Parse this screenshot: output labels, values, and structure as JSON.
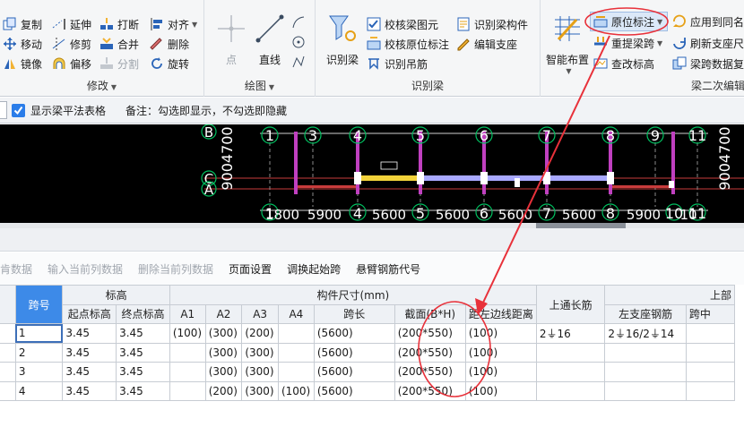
{
  "ribbon": {
    "modify": {
      "label": "修改",
      "col1": [
        "复制",
        "移动",
        "镜像"
      ],
      "col2": [
        "延伸",
        "修剪",
        "偏移"
      ],
      "col3": [
        "打断",
        "合并",
        "分割"
      ],
      "col4": [
        "对齐",
        "删除",
        "旋转"
      ]
    },
    "draw": {
      "label": "绘图",
      "point": "点",
      "line": "直线"
    },
    "identify": {
      "label": "识别梁",
      "big": "识别梁",
      "col1": [
        "校核梁图元",
        "校核原位标注",
        "识别吊筋"
      ],
      "col2": [
        "识别梁构件",
        "编辑支座"
      ]
    },
    "secondary": {
      "label": "梁二次编辑",
      "smart_layout": "智能布置",
      "col1": [
        "原位标注",
        "重提梁跨",
        "查改标高"
      ],
      "col2": [
        "应用到同名梁",
        "刷新支座尺寸",
        "梁跨数据复制"
      ]
    }
  },
  "options": {
    "show_table_label": "显示梁平法表格",
    "note": "备注：勾选即显示，不勾选即隐藏"
  },
  "canvas": {
    "axes": [
      "1",
      "3",
      "4",
      "5",
      "6",
      "7",
      "8",
      "9",
      "11"
    ],
    "bottom_axes": [
      "1",
      "4",
      "5",
      "6",
      "7",
      "8",
      "10",
      "11"
    ],
    "dims": [
      "1800",
      "5900",
      "5600",
      "5600",
      "5600",
      "5600",
      "5900",
      "10"
    ],
    "rows": [
      "B",
      "C",
      "A"
    ],
    "side_left": "9004700",
    "side_right": "9004700"
  },
  "toolbar": {
    "items": [
      "肯数据",
      "输入当前列数据",
      "删除当前列数据",
      "页面设置",
      "调换起始跨",
      "悬臂钢筋代号"
    ]
  },
  "table": {
    "h_span_no": "跨号",
    "h_elev": "标高",
    "h_start_elev": "起点标高",
    "h_end_elev": "终点标高",
    "h_dims": "构件尺寸(mm)",
    "h_a1": "A1",
    "h_a2": "A2",
    "h_a3": "A3",
    "h_a4": "A4",
    "h_span_len": "跨长",
    "h_section": "截面(B*H)",
    "h_edge_dist": "距左边线距离",
    "h_top_long": "上通长筋",
    "h_top": "上部",
    "h_left_seat": "左支座钢筋",
    "h_mid": "跨中",
    "rows": [
      {
        "span": "1",
        "start": "3.45",
        "end": "3.45",
        "a1": "(100)",
        "a2": "(300)",
        "a3": "(200)",
        "a4": "",
        "len": "(5600)",
        "sec": "(200*550)",
        "edge": "(100)",
        "toplong": "2⏚16",
        "leftseat": "2⏚16/2⏚14"
      },
      {
        "span": "2",
        "start": "3.45",
        "end": "3.45",
        "a1": "",
        "a2": "(300)",
        "a3": "(300)",
        "a4": "",
        "len": "(5600)",
        "sec": "(200*550)",
        "edge": "(100)",
        "toplong": "",
        "leftseat": ""
      },
      {
        "span": "3",
        "start": "3.45",
        "end": "3.45",
        "a1": "",
        "a2": "(300)",
        "a3": "(300)",
        "a4": "",
        "len": "(5600)",
        "sec": "(200*550)",
        "edge": "(100)",
        "toplong": "",
        "leftseat": ""
      },
      {
        "span": "4",
        "start": "3.45",
        "end": "3.45",
        "a1": "",
        "a2": "(200)",
        "a3": "(300)",
        "a4": "(100)",
        "len": "(5600)",
        "sec": "(200*550)",
        "edge": "(100)",
        "toplong": "",
        "leftseat": ""
      }
    ]
  },
  "colors": {
    "annotation": "#e8313a",
    "accent": "#3d8ae8",
    "canvas_bg": "#000000"
  }
}
